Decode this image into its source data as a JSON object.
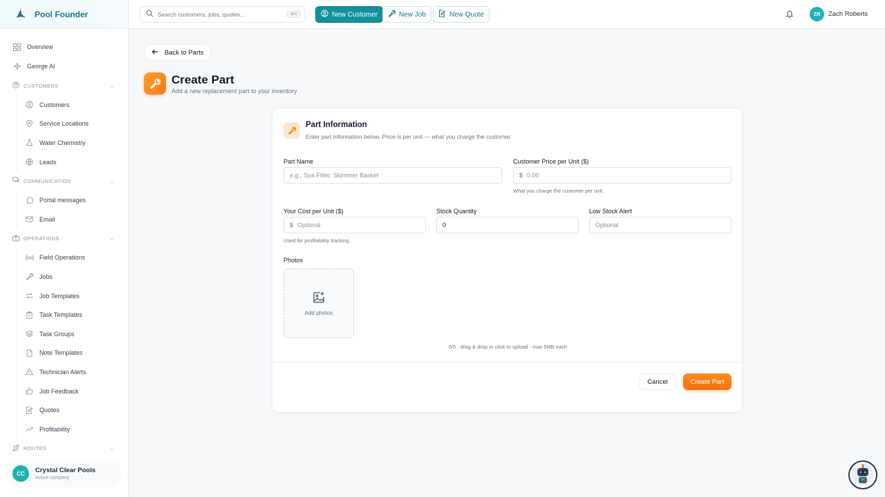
{
  "brand": {
    "title": "Pool Founder"
  },
  "search": {
    "placeholder": "Search customers, jobs, quotes...",
    "shortcut": "⌘K"
  },
  "topbar": {
    "new_customer": "New Customer",
    "new_job": "New Job",
    "new_quote": "New Quote",
    "user_initials": "ZR",
    "user_name": "Zach Roberts"
  },
  "sidebar": {
    "overview": "Overview",
    "george": "George AI",
    "sections": {
      "customers": {
        "label": "CUSTOMERS",
        "items": [
          "Customers",
          "Service Locations",
          "Water Chemistry",
          "Leads"
        ]
      },
      "communication": {
        "label": "COMMUNICATION",
        "items": [
          "Portal messages",
          "Email"
        ]
      },
      "operations": {
        "label": "OPERATIONS",
        "items": [
          "Field Operations",
          "Jobs",
          "Job Templates",
          "Task Templates",
          "Task Groups",
          "Note Templates",
          "Technician Alerts",
          "Job Feedback",
          "Quotes",
          "Profitability"
        ]
      },
      "routes": {
        "label": "ROUTES"
      }
    },
    "company": {
      "initials": "CC",
      "name": "Crystal Clear Pools",
      "status": "Active company"
    }
  },
  "page": {
    "back_label": "Back to Parts",
    "title": "Create Part",
    "subtitle": "Add a new replacement part to your inventory"
  },
  "form": {
    "title": "Part Information",
    "subtitle": "Enter part information below. Price is per unit — what you charge the customer.",
    "part_name": {
      "label": "Part Name",
      "placeholder": "e.g., Spa Filter, Skimmer Basket"
    },
    "customer_price": {
      "label": "Customer Price per Unit ($)",
      "prefix": "$",
      "placeholder": "0.00",
      "help": "What you charge the customer per unit."
    },
    "your_cost": {
      "label": "Your Cost per Unit ($)",
      "prefix": "$",
      "placeholder": "Optional",
      "help": "Used for profitability tracking."
    },
    "stock": {
      "label": "Stock Quantity",
      "value": "0"
    },
    "low_stock": {
      "label": "Low Stock Alert",
      "placeholder": "Optional"
    },
    "photos": {
      "label": "Photos",
      "add_label": "Add photos",
      "help": "0/5 · drag & drop or click to upload · max 5MB each"
    },
    "cancel": "Cancel",
    "submit": "Create Part"
  },
  "colors": {
    "teal": "#12919a",
    "orange": "#f47a14"
  }
}
